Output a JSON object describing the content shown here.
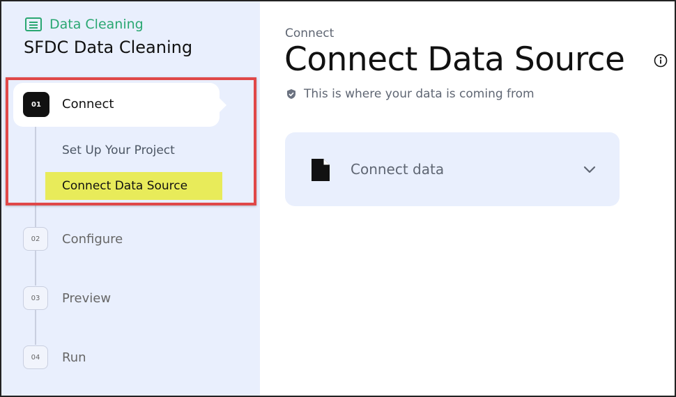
{
  "sidebar": {
    "brand_label": "Data Cleaning",
    "project_title": "SFDC Data Cleaning",
    "steps": [
      {
        "num": "01",
        "label": "Connect"
      },
      {
        "num": "02",
        "label": "Configure"
      },
      {
        "num": "03",
        "label": "Preview"
      },
      {
        "num": "04",
        "label": "Run"
      }
    ],
    "substeps": [
      {
        "label": "Set Up Your Project"
      },
      {
        "label": "Connect Data Source"
      }
    ]
  },
  "main": {
    "breadcrumb": "Connect",
    "title": "Connect Data Source",
    "subtitle": "This is where your data is coming from",
    "card_label": "Connect data"
  },
  "colors": {
    "brand_green": "#2aa772",
    "sidebar_bg": "#e9effd",
    "highlight_red": "#e04848",
    "substep_highlight": "#e8eb5a"
  },
  "icons": [
    "document-list-icon",
    "shield-check-icon",
    "info-icon",
    "file-icon",
    "chevron-down-icon"
  ]
}
